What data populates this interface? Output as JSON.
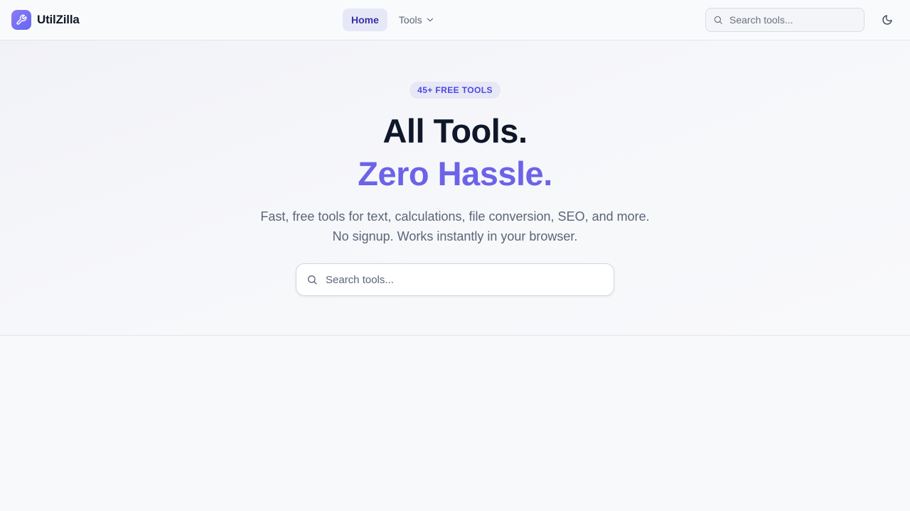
{
  "header": {
    "brand_name": "UtilZilla",
    "brand_icon": "wrench-icon",
    "nav": {
      "home_label": "Home",
      "tools_label": "Tools"
    },
    "search_placeholder": "Search tools...",
    "theme_icon": "moon-icon"
  },
  "hero": {
    "badge": "45+ FREE TOOLS",
    "title_line1": "All Tools.",
    "title_line2": "Zero Hassle.",
    "subtitle": "Fast, free tools for text, calculations, file conversion, SEO, and more. No signup. Works instantly in your browser.",
    "search_placeholder": "Search tools..."
  },
  "colors": {
    "accent": "#6c63e8",
    "brand_gradient_start": "#8b7cf6",
    "brand_gradient_end": "#6366f1",
    "nav_active_bg": "#e7e8f7",
    "nav_active_text": "#3730a3",
    "background": "#f8f9fb"
  }
}
